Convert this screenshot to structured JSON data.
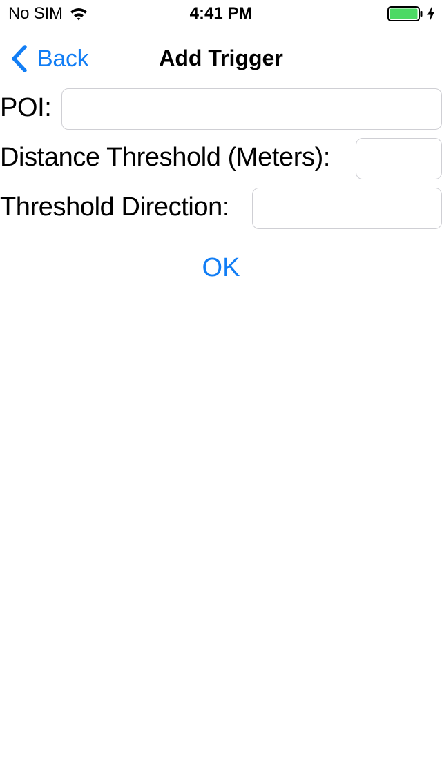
{
  "status_bar": {
    "carrier": "No SIM",
    "time": "4:41 PM",
    "wifi_icon": "wifi-icon",
    "battery_icon": "battery-icon",
    "charging_icon": "charging-bolt-icon",
    "battery_level": 1.0,
    "battery_color": "#4cd964"
  },
  "nav_bar": {
    "back_label": "Back",
    "back_icon": "chevron-left-icon",
    "title": "Add Trigger",
    "tint_color": "#127ef5"
  },
  "form": {
    "poi": {
      "label": "POI:",
      "value": ""
    },
    "distance_threshold": {
      "label": "Distance Threshold (Meters):",
      "value": ""
    },
    "threshold_direction": {
      "label": "Threshold Direction:",
      "value": ""
    },
    "ok_label": "OK"
  }
}
